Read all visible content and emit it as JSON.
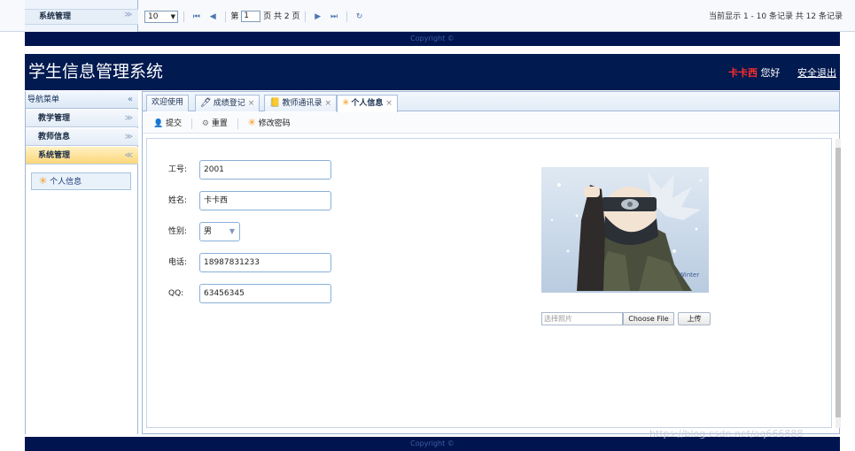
{
  "strip": {
    "sidebar_item": "系统管理",
    "chevron": "≫",
    "pager": {
      "page_size": "10",
      "page_prefix": "第",
      "page_value": "1",
      "page_suffix": "页 共 2 页",
      "first": "⏮",
      "prev": "◀",
      "next": "▶",
      "last": "⏭",
      "refresh": "↻"
    },
    "summary": "当前显示 1 - 10 条记录 共 12 条记录",
    "copyright": "Copyright ©"
  },
  "header": {
    "title": "学生信息管理系统",
    "user_name": "卡卡西",
    "greeting": "您好",
    "logout": "安全退出"
  },
  "sidebar": {
    "title": "导航菜单",
    "collapse": "«",
    "items": [
      {
        "label": "教学管理",
        "chevron": "≫"
      },
      {
        "label": "教师信息",
        "chevron": "≫"
      },
      {
        "label": "系统管理",
        "chevron": "≪"
      }
    ],
    "sub_item": "个人信息"
  },
  "tabs": [
    {
      "label": "欢迎使用",
      "icon": "",
      "closable": false
    },
    {
      "label": "成绩登记",
      "icon": "🖊",
      "closable": true
    },
    {
      "label": "教师通讯录",
      "icon": "📒",
      "closable": true
    },
    {
      "label": "个人信息",
      "icon": "✳",
      "closable": true,
      "active": true
    }
  ],
  "tab_close": "×",
  "toolbar": {
    "submit": "提交",
    "reset": "重置",
    "change_password": "修改密码"
  },
  "form": {
    "id_label": "工号:",
    "id_value": "2001",
    "name_label": "姓名:",
    "name_value": "卡卡西",
    "gender_label": "性别:",
    "gender_value": "男",
    "phone_label": "电话:",
    "phone_value": "18987831233",
    "qq_label": "QQ:",
    "qq_value": "63456345"
  },
  "upload": {
    "placeholder": "选择照片",
    "choose_file": "Choose File",
    "upload": "上传"
  },
  "footer": {
    "copyright": "Copyright ©"
  },
  "watermark": "https://blog.csdn.net/aq666888",
  "photo_caption": "Winter",
  "colors": {
    "header_bg": "#011a50",
    "user_name": "#ff2c2c",
    "active_nav": "#fbd77a",
    "accent_icon": "#f39a13"
  }
}
